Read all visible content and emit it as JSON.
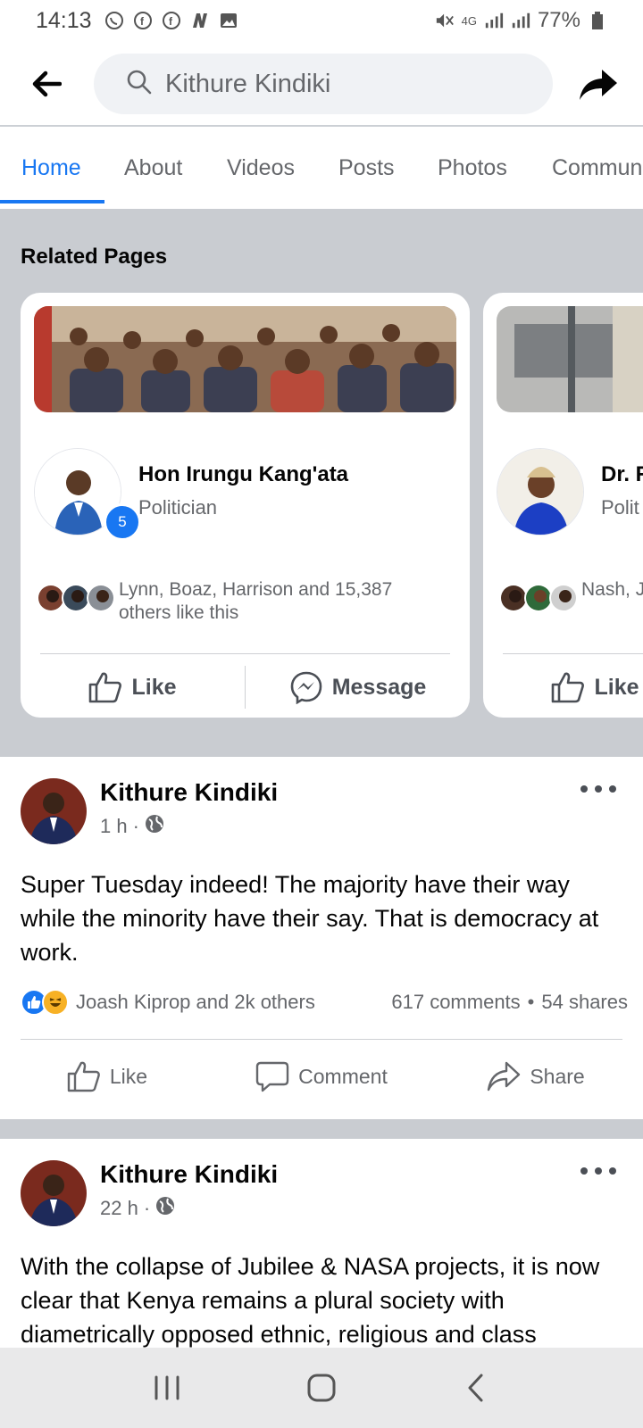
{
  "status_bar": {
    "time": "14:13",
    "battery": "77%",
    "network": "4G",
    "notification_icons": [
      "whatsapp-icon",
      "facebook-icon",
      "facebook-icon",
      "news-icon",
      "image-icon"
    ]
  },
  "header": {
    "search_value": "Kithure Kindiki"
  },
  "tabs": [
    {
      "label": "Home",
      "active": true
    },
    {
      "label": "About",
      "active": false
    },
    {
      "label": "Videos",
      "active": false
    },
    {
      "label": "Posts",
      "active": false
    },
    {
      "label": "Photos",
      "active": false
    },
    {
      "label": "Commun",
      "active": false
    }
  ],
  "related_pages": {
    "title": "Related Pages",
    "cards": [
      {
        "name": "Hon Irungu Kang'ata",
        "category": "Politician",
        "badge": "5",
        "friends_text": "Lynn, Boaz, Harrison and 15,387 others like this",
        "like_label": "Like",
        "message_label": "Message"
      },
      {
        "name": "Dr. R",
        "category": "Polit",
        "friends_text": "Nash, J others",
        "like_label": "Like"
      }
    ]
  },
  "posts": [
    {
      "author": "Kithure Kindiki",
      "time": "1 h",
      "text": "Super Tuesday indeed! The majority have their way while the minority have their say. That is democracy at work.",
      "reactions_text": "Joash Kiprop and 2k others",
      "comments": "617 comments",
      "shares": "54 shares",
      "like_label": "Like",
      "comment_label": "Comment",
      "share_label": "Share"
    },
    {
      "author": "Kithure Kindiki",
      "time": "22 h",
      "text": "With the collapse of Jubilee & NASA projects, it is now clear that Kenya remains a plural society with diametrically opposed ethnic, religious and class"
    }
  ],
  "colors": {
    "accent": "#1877f2",
    "section_bg": "#c9ccd1",
    "secondary_text": "#65676b"
  }
}
